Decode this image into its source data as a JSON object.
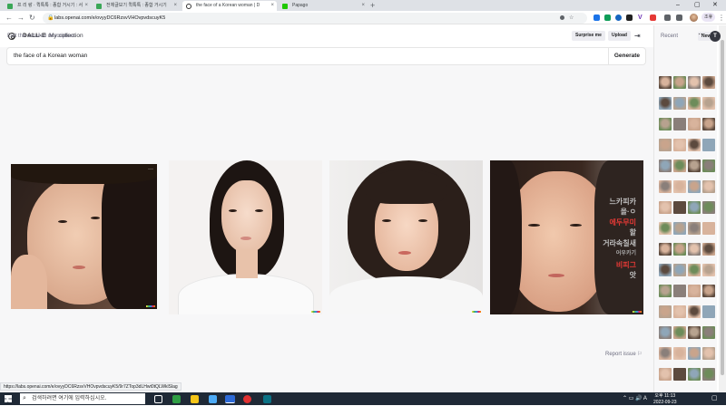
{
  "browser": {
    "tabs": [
      {
        "label": "프 리 랑 · 퀵톡톡 : 종합 거시기 : 서",
        "fav": "#3aa757"
      },
      {
        "label": "전체글보기 퀵톡톡 : 종합 거시기",
        "fav": "#3aa757"
      },
      {
        "label": "the face of a Korean woman | D",
        "fav": "#ffffff"
      },
      {
        "label": "Papago",
        "fav": "#1ec800"
      }
    ],
    "url": "labs.openai.com/e/ovyyDC6RzsvVHOvpvdscuyK5",
    "profile_label": "조휴",
    "status_url": "https://labs.openai.com/e/ovyyDC6RzsvVHOvpvdscuyK5/9r7ZTop3dLHwt0tQLWklSlag"
  },
  "app": {
    "brand": "DALL·E",
    "nav": "My collection",
    "avatar_letter": "T",
    "edit_label": "Edit the detailed description",
    "surprise_label": "Surprise me",
    "upload_label": "Upload",
    "prompt": "the face of a Korean woman",
    "generate_label": "Generate",
    "report_label": "Report issue",
    "image4_text": [
      "느카피카",
      "을·ㅇ",
      "에두무미",
      "할",
      "거라속칠새",
      "어우카기",
      "비피그",
      "앗"
    ]
  },
  "sidebar": {
    "recent_label": "Recent",
    "new_label": "New"
  },
  "taskbar": {
    "search_placeholder": "검색하려면 여기에 입력하십시오.",
    "time": "오후 11:13",
    "date": "2022-09-23",
    "lang": "A"
  }
}
